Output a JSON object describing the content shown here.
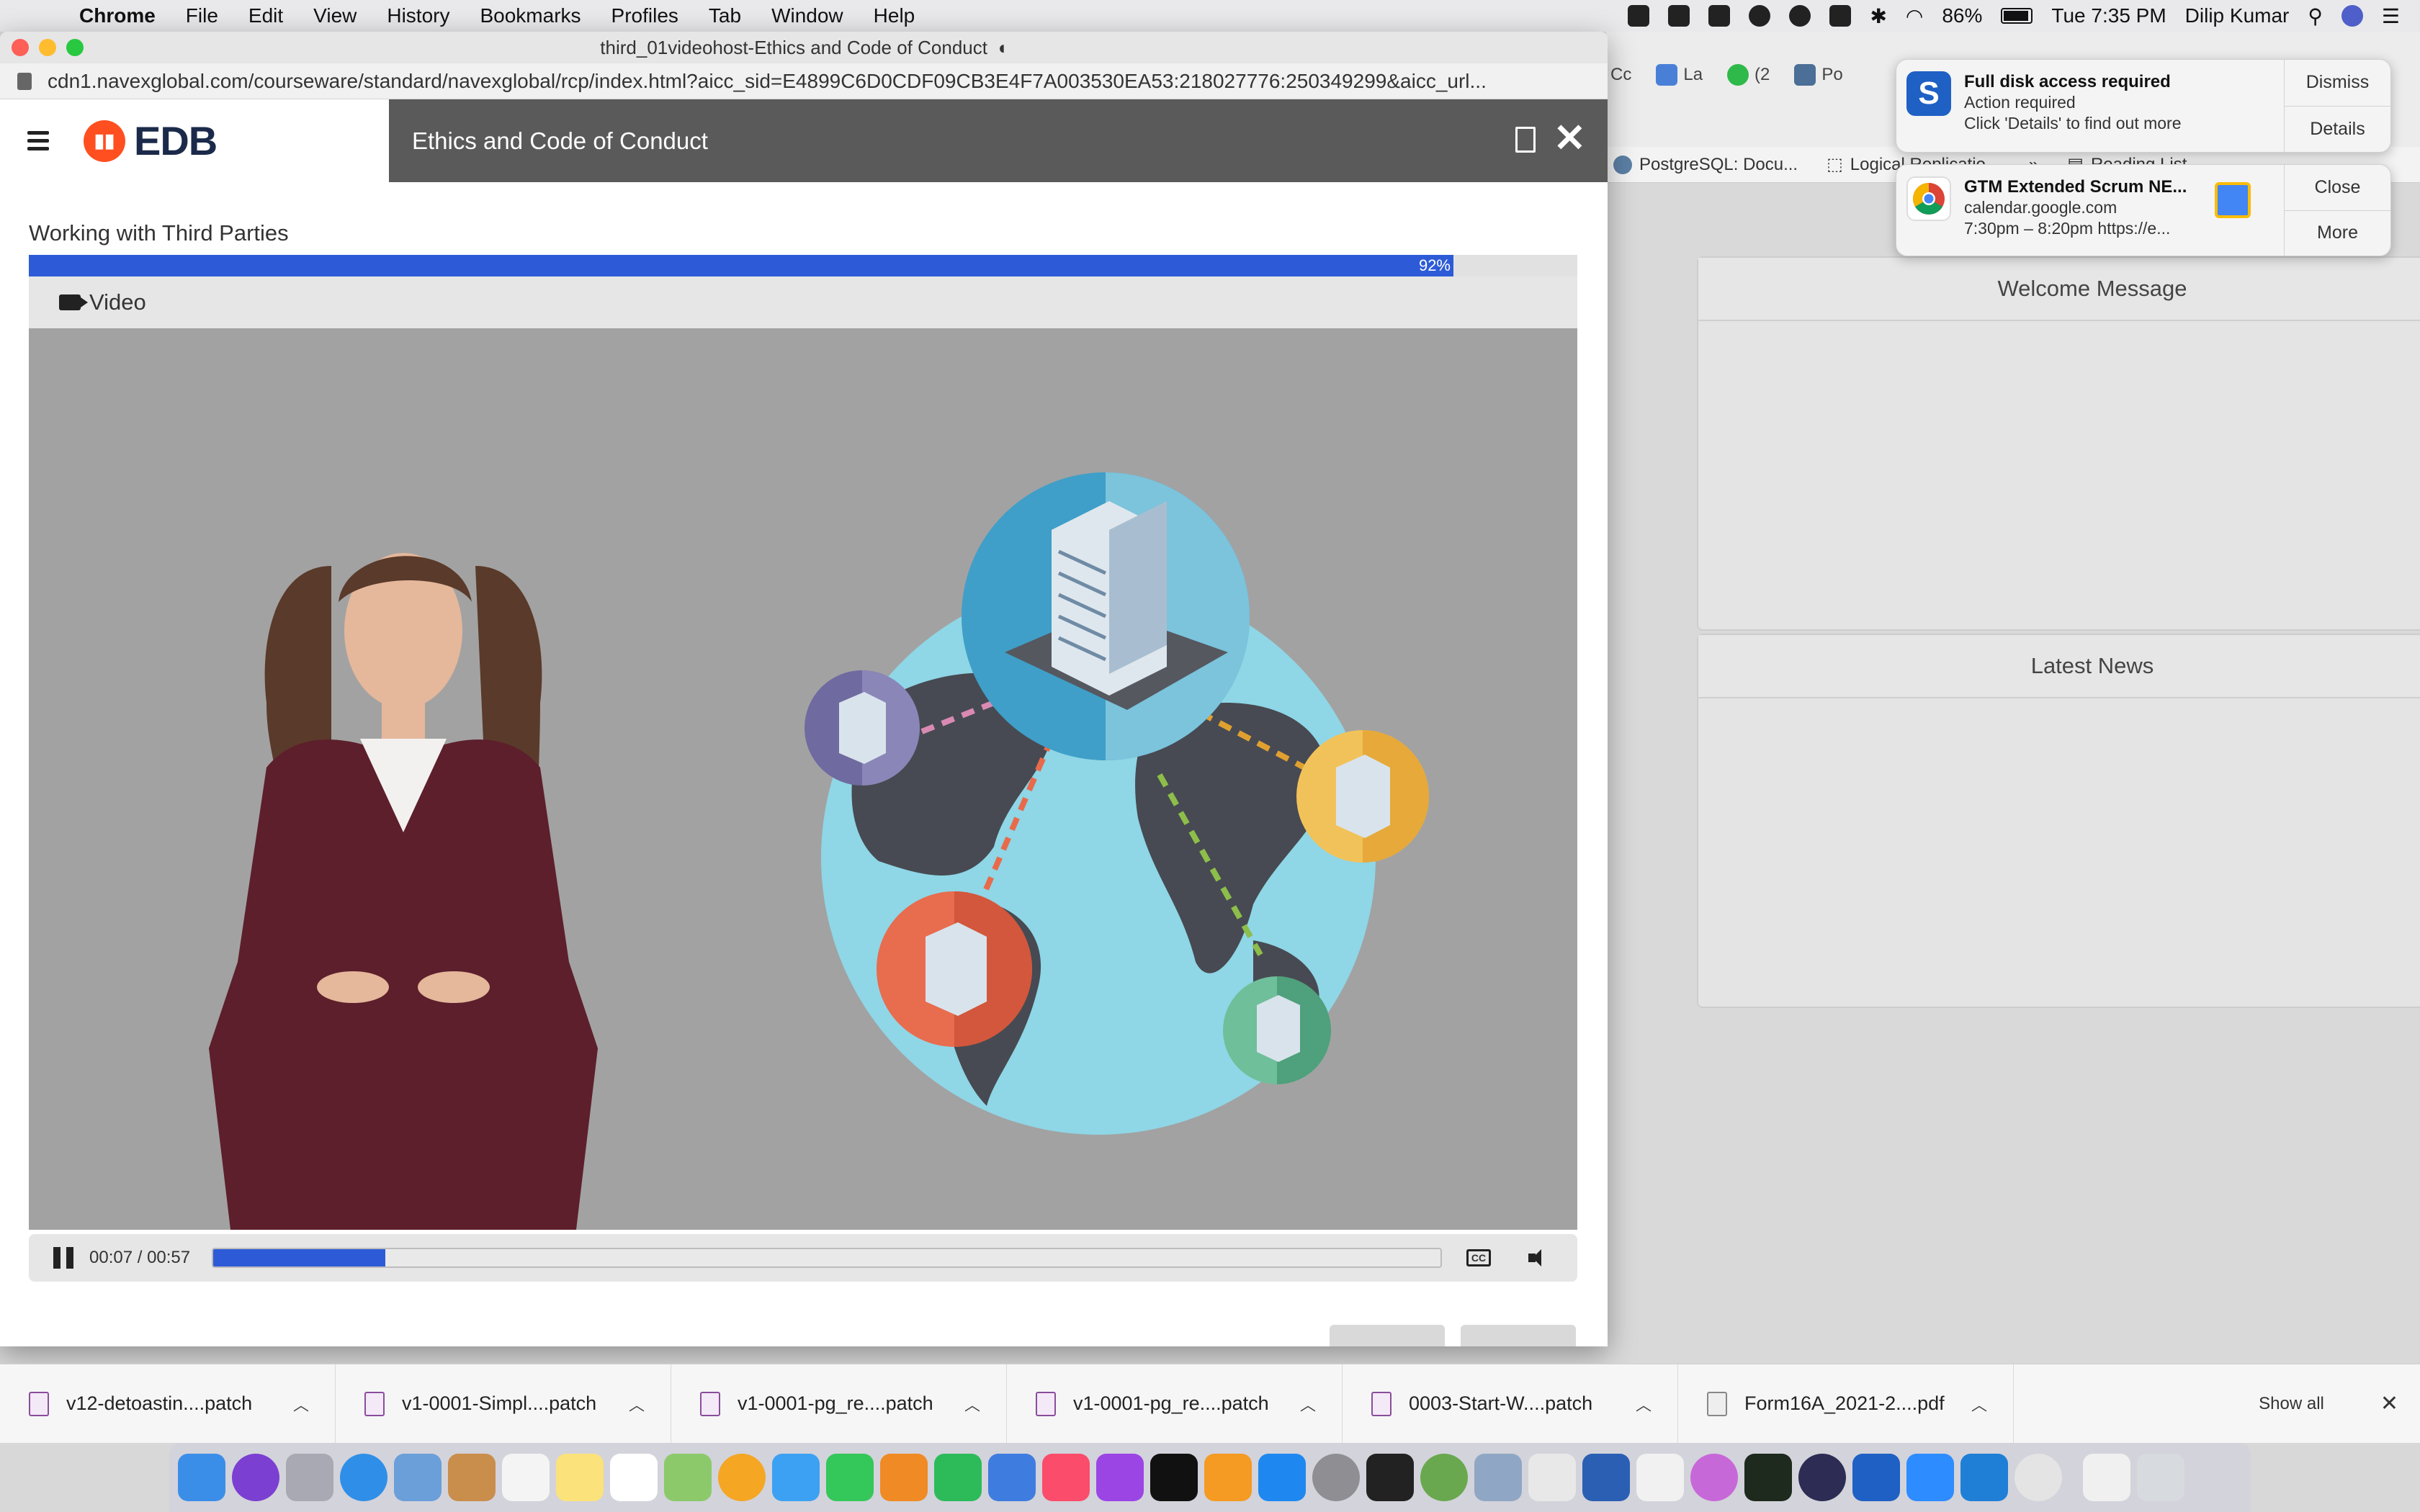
{
  "menubar": {
    "app_name": "Chrome",
    "menus": [
      "File",
      "Edit",
      "View",
      "History",
      "Bookmarks",
      "Profiles",
      "Tab",
      "Window",
      "Help"
    ],
    "battery": "86%",
    "clock": "Tue 7:35 PM",
    "user": "Dilip Kumar"
  },
  "window": {
    "title": "third_01videohost-Ethics and Code of Conduct",
    "url": "cdn1.navexglobal.com/courseware/standard/navexglobal/rcp/index.html?aicc_sid=E4899C6D0CDF09CB3E4F7A003530EA53:218027776:250349299&aicc_url..."
  },
  "app": {
    "logo_text": "EDB",
    "course_title": "Ethics and Code of Conduct"
  },
  "lesson": {
    "section_title": "Working with Third Parties",
    "progress_percent": 92,
    "progress_label": "92%",
    "tab_label": "Video"
  },
  "player": {
    "time": "00:07 / 00:57",
    "played_fraction": 0.14,
    "cc_label": "CC"
  },
  "background_window": {
    "tabs": [
      "Cc",
      "La",
      "(2",
      "Po"
    ],
    "bookmarks": [
      "PostgreSQL: Docu...",
      "Logical Replicatio...",
      "»",
      "Reading List"
    ],
    "panels": [
      "Welcome Message",
      "Latest News"
    ]
  },
  "notifications": [
    {
      "title": "Full disk access required",
      "line1": "Action required",
      "line2": "Click 'Details' to find out more",
      "actions": [
        "Dismiss",
        "Details"
      ]
    },
    {
      "title": "GTM Extended Scrum NE...",
      "line1": "calendar.google.com",
      "line2": "7:30pm – 8:20pm https://e...",
      "actions": [
        "Close",
        "More"
      ]
    }
  ],
  "downloads": {
    "items": [
      "v12-detoastin....patch",
      "v1-0001-Simpl....patch",
      "v1-0001-pg_re....patch",
      "v1-0001-pg_re....patch",
      "0003-Start-W....patch",
      "Form16A_2021-2....pdf"
    ],
    "show_all": "Show all"
  },
  "colors": {
    "accent_blue": "#2d5bd8",
    "title_bar_gray": "#5a5a5a",
    "logo_orange": "#ff4f20"
  }
}
